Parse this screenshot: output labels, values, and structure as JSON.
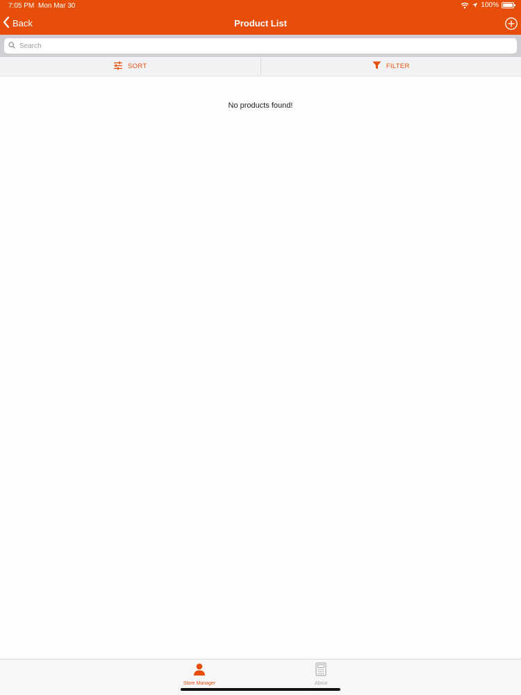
{
  "status_bar": {
    "time": "7:05 PM",
    "date": "Mon Mar 30",
    "battery": "100%"
  },
  "nav": {
    "back_label": "Back",
    "title": "Product List"
  },
  "search": {
    "placeholder": "Search"
  },
  "toolbar": {
    "sort_label": "SORT",
    "filter_label": "FILTER"
  },
  "content": {
    "empty_message": "No products found!"
  },
  "tabs": [
    {
      "label": "Store Manager",
      "icon": "person-icon",
      "selected": true
    },
    {
      "label": "About",
      "icon": "calculator-icon",
      "selected": false
    }
  ],
  "colors": {
    "accent": "#e74e0a",
    "inactive": "#a8a8a8",
    "search_bg": "#cfcfd3"
  }
}
